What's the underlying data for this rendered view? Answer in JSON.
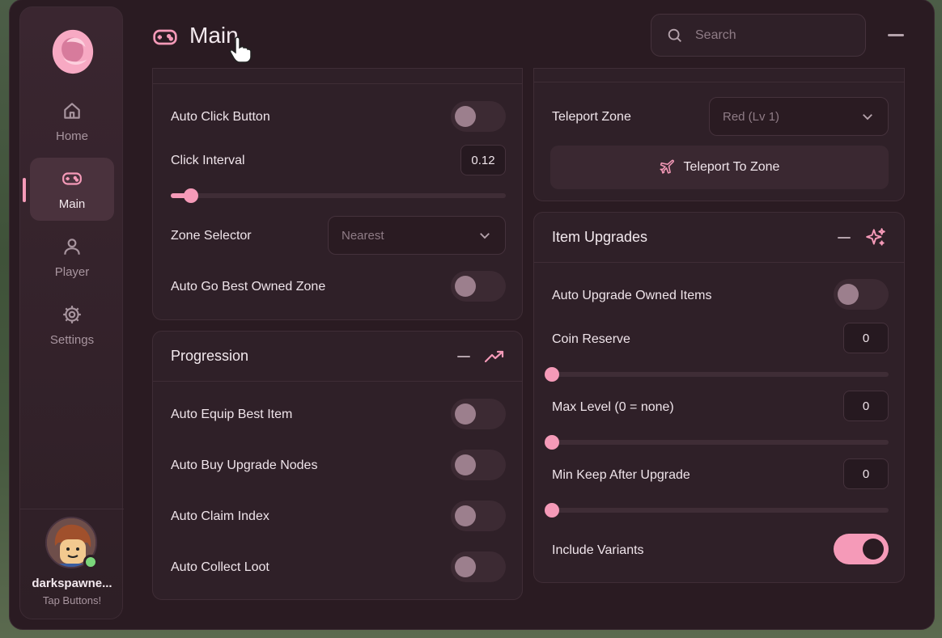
{
  "header": {
    "title": "Main"
  },
  "search": {
    "placeholder": "Search"
  },
  "sidebar": {
    "items": [
      {
        "label": "Home"
      },
      {
        "label": "Main"
      },
      {
        "label": "Player"
      },
      {
        "label": "Settings"
      }
    ],
    "user": {
      "name": "darkspawne...",
      "status": "Tap Buttons!"
    }
  },
  "clicker": {
    "auto_click_label": "Auto Click Button",
    "auto_click_on": false,
    "interval_label": "Click Interval",
    "interval_value": "0.12",
    "interval_slider_value": 0.06,
    "zone_selector_label": "Zone Selector",
    "zone_selector_value": "Nearest",
    "auto_best_zone_label": "Auto Go Best Owned Zone",
    "auto_best_zone_on": false
  },
  "progression": {
    "title": "Progression",
    "items": [
      {
        "label": "Auto Equip Best Item",
        "on": false
      },
      {
        "label": "Auto Buy Upgrade Nodes",
        "on": false
      },
      {
        "label": "Auto Claim Index",
        "on": false
      },
      {
        "label": "Auto Collect Loot",
        "on": false
      }
    ]
  },
  "teleport": {
    "zone_label": "Teleport Zone",
    "zone_value": "Red (Lv 1)",
    "button_label": "Teleport To Zone"
  },
  "item_upgrades": {
    "title": "Item Upgrades",
    "auto_upgrade_label": "Auto Upgrade Owned Items",
    "auto_upgrade_on": false,
    "coin_reserve_label": "Coin Reserve",
    "coin_reserve_value": "0",
    "max_level_label": "Max Level (0 = none)",
    "max_level_value": "0",
    "min_keep_label": "Min Keep After Upgrade",
    "min_keep_value": "0",
    "include_variants_label": "Include Variants",
    "include_variants_on": true
  },
  "colors": {
    "accent": "#f59ab8",
    "bg": "#2a1b22",
    "panel": "#2f2028"
  }
}
